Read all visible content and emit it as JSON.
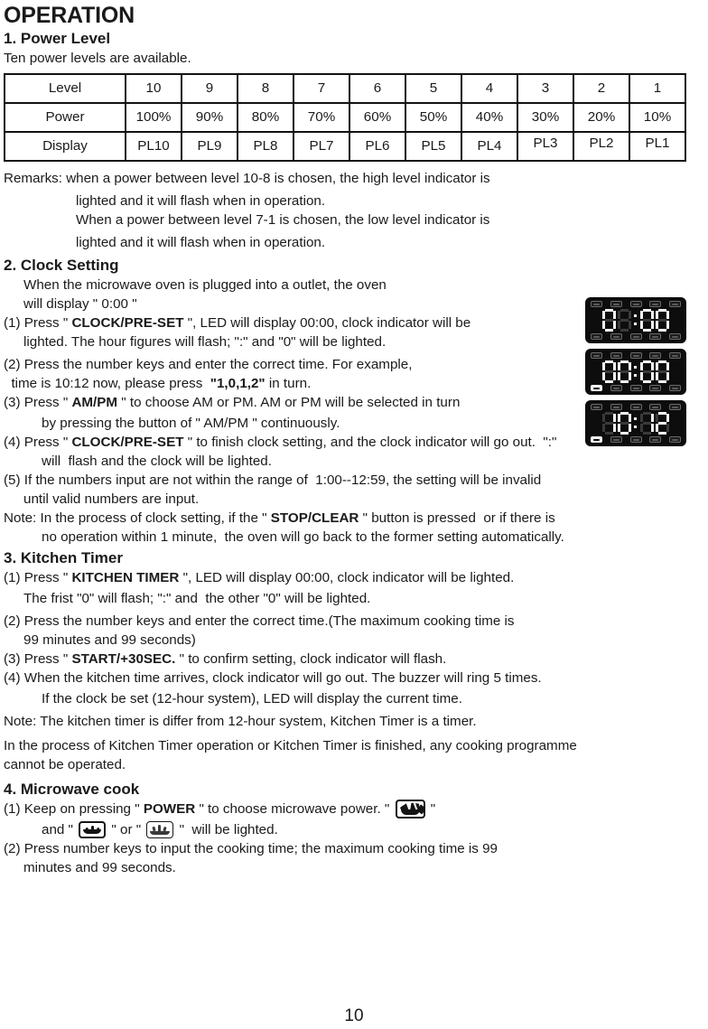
{
  "page": {
    "title": "OPERATION",
    "number": "10"
  },
  "sections": {
    "power_level": {
      "heading": "1. Power Level",
      "intro": "Ten power levels are available.",
      "table": {
        "row_labels": [
          "Level",
          "Power",
          "Display"
        ],
        "levels": [
          "10",
          "9",
          "8",
          "7",
          "6",
          "5",
          "4",
          "3",
          "2",
          "1"
        ],
        "powers": [
          "100%",
          "90%",
          "80%",
          "70%",
          "60%",
          "50%",
          "40%",
          "30%",
          "20%",
          "10%"
        ],
        "displays": [
          "PL10",
          "PL9",
          "PL8",
          "PL7",
          "PL6",
          "PL5",
          "PL4",
          "PL3",
          "PL2",
          "PL1"
        ]
      },
      "remarks": [
        "Remarks: when a power between level 10-8 is chosen, the high level indicator is",
        "lighted and it will flash when in operation.",
        "When a power between level 7-1 is chosen, the low level indicator is",
        "lighted and it will flash when in operation."
      ]
    },
    "clock_setting": {
      "heading": "2. Clock Setting",
      "intro_line_1": "When the microwave oven is plugged into a outlet, the oven",
      "intro_line_2": "will display \" 0:00 \"",
      "step1_pre": "(1) Press \" ",
      "step1_bold": "CLOCK/PRE-SET",
      "step1_post": " \", LED will display 00:00, clock indicator will be",
      "step1_cont": "lighted. The hour figures will flash; \":\" and \"0\" will be lighted.",
      "step2_line1": "(2) Press the number keys and enter the correct time. For example,",
      "step2_line2_pre": "  time is 10:12 now, please press  ",
      "step2_line2_bold": "\"1,0,1,2\"",
      "step2_line2_post": " in turn.",
      "step3_pre": "(3) Press \" ",
      "step3_bold": "AM/PM",
      "step3_post": " \" to choose AM or PM. AM or PM will be selected in turn",
      "step3_cont": "by pressing the button of \" AM/PM \" continuously.",
      "step4_pre": "(4) Press \" ",
      "step4_bold": "CLOCK/PRE-SET",
      "step4_post": " \" to finish clock setting, and the clock indicator will go out.  \":\"",
      "step4_cont": "will  flash and the clock will be lighted.",
      "step5_line1": "(5) If the numbers input are not within the range of  1:00--12:59, the setting will be invalid",
      "step5_line2": "until valid numbers are input.",
      "note_pre": "Note: In the process of clock setting, if the \" ",
      "note_bold": "STOP/CLEAR",
      "note_post": " \" button is pressed  or if there is",
      "note_cont": "no operation within 1 minute,  the oven will go back to the former setting automatically."
    },
    "kitchen_timer": {
      "heading": "3. Kitchen Timer",
      "step1_pre": "(1) Press \" ",
      "step1_bold": "KITCHEN TIMER",
      "step1_post": " \", LED will display 00:00, clock indicator will be lighted.",
      "step1_cont": "The frist \"0\" will flash; \":\" and  the other \"0\" will be lighted.",
      "step2_line1": "(2) Press the number keys and enter the correct time.(The maximum cooking time is",
      "step2_line2": "99 minutes and 99 seconds)",
      "step3_pre": "(3) Press \" ",
      "step3_bold": "START/+30SEC.",
      "step3_post": " \" to confirm setting, clock indicator will flash.",
      "step4_line1": "(4) When the kitchen time arrives, clock indicator will go out. The buzzer will ring 5 times.",
      "step4_line2": "If the clock be set (12-hour system), LED will display the current time.",
      "note": "Note: The kitchen timer is differ from 12-hour system, Kitchen Timer is a timer.",
      "closing_line1": "In the process of Kitchen Timer operation or Kitchen Timer is finished, any cooking programme",
      "closing_line2": "cannot be operated."
    },
    "microwave_cook": {
      "heading": "4. Microwave cook",
      "step1_pre": "(1) Keep on pressing \" ",
      "step1_bold": "POWER",
      "step1_post": " \" to choose microwave power. \" ",
      "step1_tail": " \"",
      "step1_cont_a": "and \" ",
      "step1_cont_b": " \" or \" ",
      "step1_cont_c": " \"  will be lighted.",
      "step2_line1": "(2) Press number keys to input the cooking time; the maximum cooking time is 99",
      "step2_line2": "minutes and 99 seconds."
    }
  },
  "led_displays": [
    {
      "name": "led-display-zero-colon-zero-zero",
      "digits": [
        "0",
        "",
        "0",
        "0"
      ],
      "value": "0:00",
      "top_indicators": [
        0,
        0,
        0,
        0,
        0
      ],
      "bottom_indicators": [
        0,
        0,
        0,
        0,
        0
      ]
    },
    {
      "name": "led-display-clock-set",
      "digits": [
        "0",
        "0",
        "0",
        "0"
      ],
      "value": "00:00",
      "top_indicators": [
        0,
        0,
        0,
        0,
        0
      ],
      "bottom_indicators": [
        1,
        0,
        0,
        0,
        0
      ]
    },
    {
      "name": "led-display-ten-twelve",
      "digits": [
        "1",
        "0",
        "1",
        "2"
      ],
      "value": "10:12",
      "top_indicators": [
        0,
        0,
        0,
        0,
        0
      ],
      "bottom_indicators": [
        1,
        0,
        0,
        0,
        0
      ]
    }
  ],
  "icons": {
    "microwave_power": "microwave-power-icon",
    "high_level_indicator": "high-level-heat-indicator-icon",
    "low_level_indicator": "low-level-heat-indicator-icon"
  },
  "colors": {
    "text": "#1a1a1a",
    "background": "#ffffff",
    "table_border": "#121212",
    "led_background": "#0d0d0d",
    "led_segment_on": "#f4f4f4",
    "led_segment_off": "#3a3a3a"
  }
}
